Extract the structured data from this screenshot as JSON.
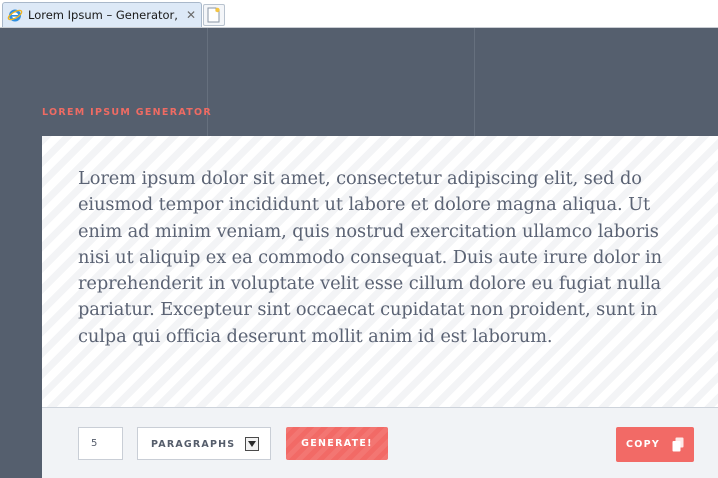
{
  "browser": {
    "tab_title": "Lorem Ipsum – Generator, ...",
    "tab_close": "✕",
    "icons": [
      "ie-icon",
      "close-icon",
      "new-tab-icon"
    ]
  },
  "app": {
    "title": "LOREM IPSUM GENERATOR",
    "output": "Lorem ipsum dolor sit amet, consectetur adipiscing elit, sed do eiusmod tempor incididunt ut labore et dolore magna aliqua. Ut enim ad minim veniam, quis nostrud exercitation ullamco laboris nisi ut aliquip ex ea commodo consequat. Duis aute irure dolor in reprehenderit in voluptate velit esse cillum dolore eu fugiat nulla pariatur. Excepteur sint occaecat cupidatat non proident, sunt in culpa qui officia deserunt mollit anim id est laborum."
  },
  "controls": {
    "count_value": "5",
    "unit_selected": "PARAGRAPHS",
    "generate_label": "GENERATE!",
    "copy_label": "COPY",
    "icons": [
      "chevron-down-icon",
      "copy-icon"
    ]
  },
  "colors": {
    "background": "#555f6e",
    "accent": "#f26a66",
    "text": "#5b6374",
    "tab_bg": "#dde9f7"
  }
}
